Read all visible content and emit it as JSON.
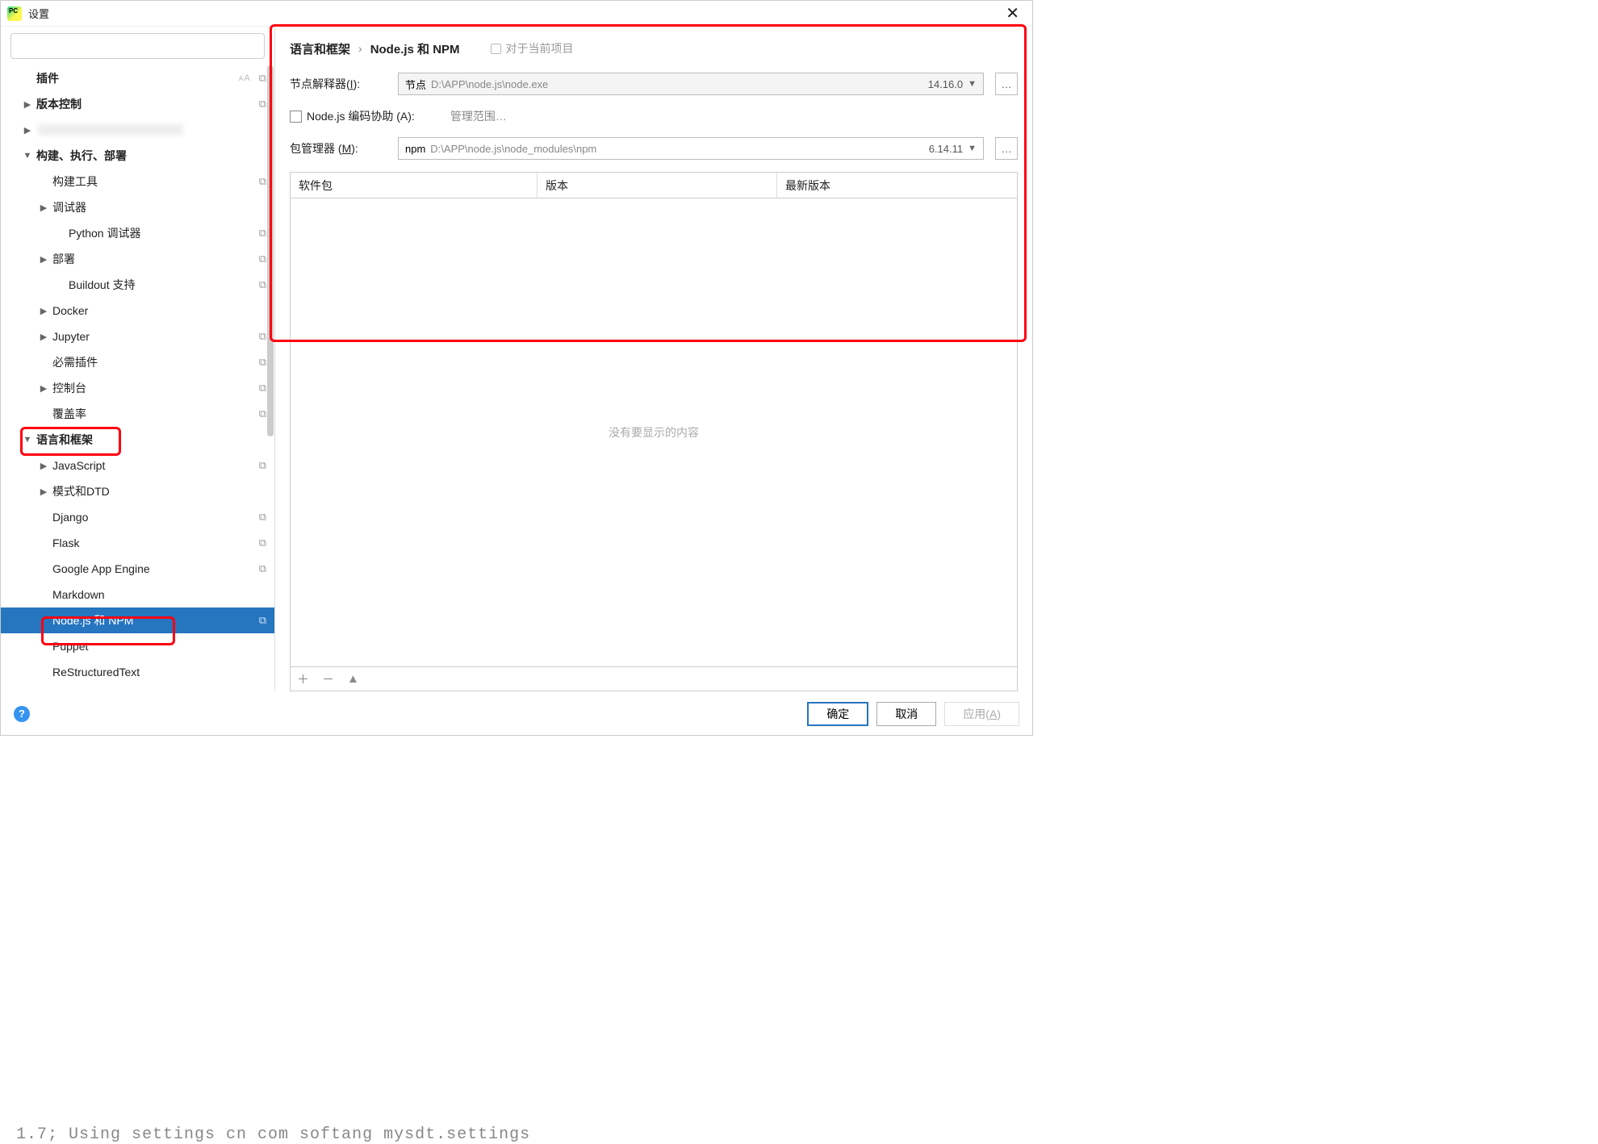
{
  "dialog": {
    "title": "设置"
  },
  "search": {
    "placeholder": ""
  },
  "tree": {
    "plugins": "插件",
    "version_control": "版本控制",
    "blurred": "",
    "build_exec_deploy": "构建、执行、部署",
    "build_tools": "构建工具",
    "debugger": "调试器",
    "python_debugger": "Python 调试器",
    "deploy": "部署",
    "buildout": "Buildout 支持",
    "docker": "Docker",
    "jupyter": "Jupyter",
    "required_plugins": "必需插件",
    "console": "控制台",
    "coverage": "覆盖率",
    "lang_frameworks": "语言和框架",
    "javascript": "JavaScript",
    "schema_dtd": "模式和DTD",
    "django": "Django",
    "flask": "Flask",
    "gae": "Google App Engine",
    "markdown": "Markdown",
    "nodejs": "Node.js 和 NPM",
    "puppet": "Puppet",
    "restructuredtext": "ReStructuredText"
  },
  "breadcrumb": {
    "p1": "语言和框架",
    "sep": "›",
    "p2": "Node.js 和 NPM",
    "hint": "对于当前项目"
  },
  "form": {
    "interpreter_label": "节点解释器(",
    "interpreter_shortcut": "I",
    "interpreter_label_end": "):",
    "interpreter_prefix": "节点",
    "interpreter_path": "D:\\APP\\node.js\\node.exe",
    "interpreter_version": "14.16.0",
    "coding_assist_prefix": "Node.js 编码协助 (",
    "coding_assist_u": "A",
    "coding_assist_suffix": "):",
    "manage_scope": "管理范围…",
    "package_mgr_label": "包管理器 (",
    "package_mgr_u": "M",
    "package_mgr_label_end": "):",
    "package_mgr_prefix": "npm",
    "package_mgr_path": "D:\\APP\\node.js\\node_modules\\npm",
    "package_mgr_version": "6.14.11"
  },
  "table": {
    "col_package": "软件包",
    "col_version": "版本",
    "col_latest": "最新版本",
    "empty": "没有要显示的内容"
  },
  "footer": {
    "ok": "确定",
    "cancel": "取消",
    "apply_prefix": "应用(",
    "apply_u": "A",
    "apply_suffix": ")"
  },
  "bg": "1.7; Using settings  cn com softang  mysdt.settings"
}
